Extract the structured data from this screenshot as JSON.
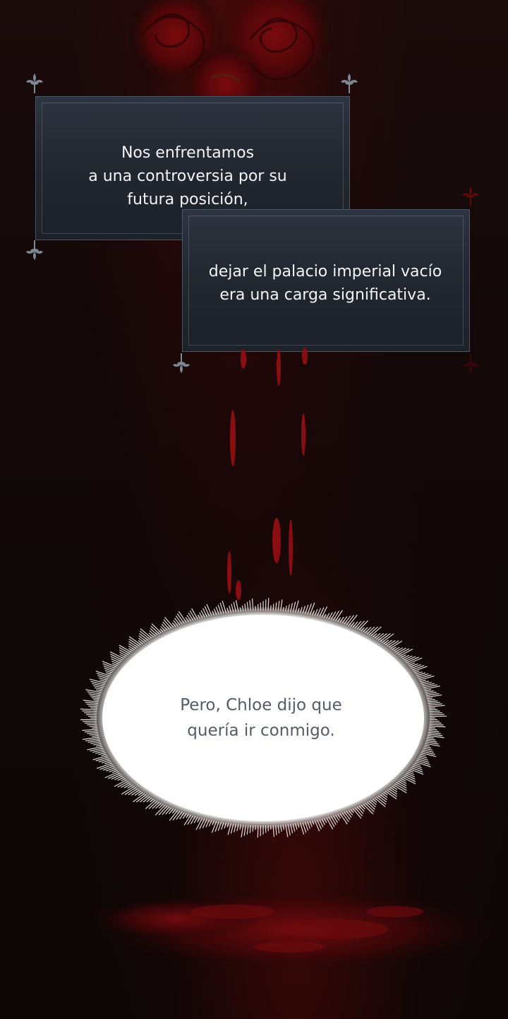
{
  "captions": {
    "first": "Nos enfrentamos\na una controversia por su\nfutura posición,",
    "second": "dejar el palacio imperial vacío\nera una carga significativa."
  },
  "speech_bubble": {
    "text": "Pero, Chloe dijo que\nquería ir conmigo."
  },
  "colors": {
    "background": "#100707",
    "caption_box": "#222831",
    "caption_text": "#f4f4f6",
    "blood": "#8a0d12",
    "bubble_fill": "#ffffff",
    "bubble_text": "#555b66"
  },
  "icons": {
    "corner_ornament": "fleur-de-lis-icon",
    "background_art": "red-roses-illustration"
  }
}
